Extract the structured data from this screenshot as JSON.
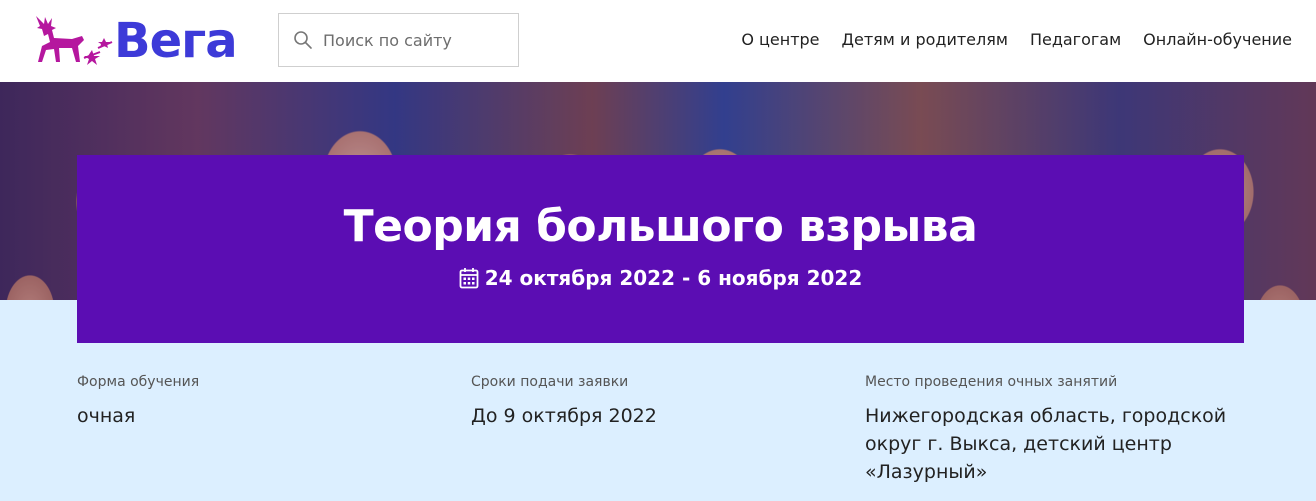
{
  "header": {
    "logo_text": "Вега",
    "search_placeholder": "Поиск по сайту",
    "nav": [
      "О центре",
      "Детям и родителям",
      "Педагогам",
      "Онлайн-обучение"
    ]
  },
  "banner": {
    "title": "Теория большого взрыва",
    "dates": "24 октября 2022 - 6 ноября 2022"
  },
  "info": [
    {
      "label": "Форма обучения",
      "value": "очная"
    },
    {
      "label": "Сроки подачи заявки",
      "value": "До 9 октября 2022"
    },
    {
      "label": "Место проведения очных занятий",
      "value": "Нижегородская область, городской округ г. Выкса, детский центр «Лазурный»"
    }
  ],
  "icons": {
    "logo": "deer-logo-icon",
    "search": "search-icon",
    "dates": "calendar-icon"
  },
  "colors": {
    "brand_blue": "#3d3ad8",
    "brand_magenta": "#b5179e",
    "banner_bg": "#5b0db3",
    "info_bg": "#dcefff"
  }
}
